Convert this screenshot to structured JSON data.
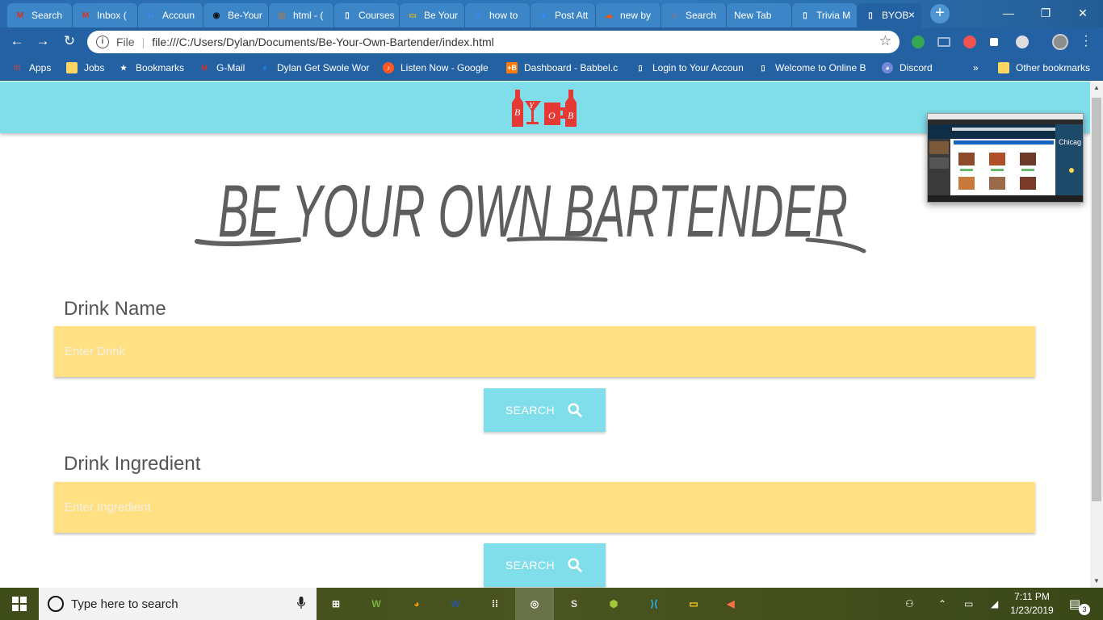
{
  "browser": {
    "tabs": [
      {
        "label": "Search",
        "icon": "gmail-icon",
        "color": "#d93025",
        "glyph": "M"
      },
      {
        "label": "Inbox (",
        "icon": "gmail-icon",
        "color": "#d93025",
        "glyph": "M"
      },
      {
        "label": "Accoun",
        "icon": "google-icon",
        "color": "#4285f4",
        "glyph": "G"
      },
      {
        "label": "Be-Your",
        "icon": "github-icon",
        "color": "#111111",
        "glyph": "◉"
      },
      {
        "label": "html - (",
        "icon": "stackoverflow-icon",
        "color": "#8c7b6b",
        "glyph": "▤"
      },
      {
        "label": "Courses",
        "icon": "page-icon",
        "color": "#ffffff",
        "glyph": "▯"
      },
      {
        "label": "Be Your",
        "icon": "slides-icon",
        "color": "#f4b400",
        "glyph": "▭"
      },
      {
        "label": "how to",
        "icon": "google-icon",
        "color": "#4285f4",
        "glyph": "G"
      },
      {
        "label": "Post Att",
        "icon": "zoom-icon",
        "color": "#2d8cff",
        "glyph": "●"
      },
      {
        "label": "new by",
        "icon": "soundcloud-icon",
        "color": "#ff5500",
        "glyph": "☁"
      },
      {
        "label": "Search",
        "icon": "music-icon",
        "color": "#ff5722",
        "glyph": "♪"
      },
      {
        "label": "New Tab",
        "icon": "",
        "color": "",
        "glyph": ""
      },
      {
        "label": "Trivia M",
        "icon": "page-icon",
        "color": "#ffffff",
        "glyph": "▯"
      },
      {
        "label": "BYOB",
        "icon": "page-icon",
        "color": "#ffffff",
        "glyph": "▯"
      }
    ],
    "active_tab_close": "×",
    "new_tab": "+",
    "window_controls": {
      "minimize": "—",
      "maximize": "❐",
      "close": "✕"
    },
    "url": "file:///C:/Users/Dylan/Documents/Be-Your-Own-Bartender/index.html",
    "url_scheme_label": "File",
    "bookmarks": [
      {
        "label": "Apps",
        "icon": "apps-icon",
        "color": "#e94235",
        "glyph": "⁞⁞⁞"
      },
      {
        "label": "Jobs",
        "icon": "folder-icon",
        "color": "#fdd663",
        "glyph": ""
      },
      {
        "label": "Bookmarks",
        "icon": "star-icon",
        "color": "#ffffff",
        "glyph": "★"
      },
      {
        "label": "G-Mail",
        "icon": "gmail-icon",
        "color": "#d93025",
        "glyph": "M"
      },
      {
        "label": "Dylan Get Swole Wor",
        "icon": "edge-icon",
        "color": "#1e88e5",
        "glyph": "e"
      },
      {
        "label": "Listen Now - Google",
        "icon": "music-icon",
        "color": "#ff5722",
        "glyph": "♪"
      },
      {
        "label": "Dashboard - Babbel.c",
        "icon": "babbel-icon",
        "color": "#ff7a00",
        "glyph": "+B"
      },
      {
        "label": "Login to Your Accoun",
        "icon": "page-icon",
        "color": "#ffffff",
        "glyph": "▯"
      },
      {
        "label": "Welcome to Online B",
        "icon": "page-icon",
        "color": "#ffffff",
        "glyph": "▯"
      },
      {
        "label": "Discord",
        "icon": "discord-icon",
        "color": "#7289da",
        "glyph": "◕"
      }
    ],
    "bookmarks_overflow": "»",
    "other_bookmarks": "Other bookmarks"
  },
  "page": {
    "brand_color": "#80deea",
    "field_color": "#ffe082",
    "logo_letters": [
      "B",
      "Y",
      "O",
      "B"
    ],
    "hero_title": "BE YOUR OWN BARTENDER",
    "drink_name": {
      "label": "Drink Name",
      "placeholder": "Enter Drink",
      "button": "SEARCH"
    },
    "drink_ingredient": {
      "label": "Drink Ingredient",
      "placeholder": "Enter Ingredient",
      "button": "SEARCH"
    },
    "thumbnail_text": "Chicag"
  },
  "taskbar": {
    "search_placeholder": "Type here to search",
    "clock_time": "7:11 PM",
    "clock_date": "1/23/2019",
    "notification_count": "3",
    "apps": [
      {
        "name": "task-view-icon",
        "glyph": "⊞"
      },
      {
        "name": "wunderlist-icon",
        "glyph": "W"
      },
      {
        "name": "color-app-icon",
        "glyph": "◕"
      },
      {
        "name": "word-icon",
        "glyph": "W"
      },
      {
        "name": "apps-grid-icon",
        "glyph": "⁞⁞"
      },
      {
        "name": "chrome-icon",
        "glyph": "◎"
      },
      {
        "name": "slack-icon",
        "glyph": "S"
      },
      {
        "name": "android-studio-icon",
        "glyph": "⬢"
      },
      {
        "name": "vscode-icon",
        "glyph": "⟩⟨"
      },
      {
        "name": "file-explorer-icon",
        "glyph": "▭"
      },
      {
        "name": "volume-app-icon",
        "glyph": "◀"
      }
    ]
  }
}
